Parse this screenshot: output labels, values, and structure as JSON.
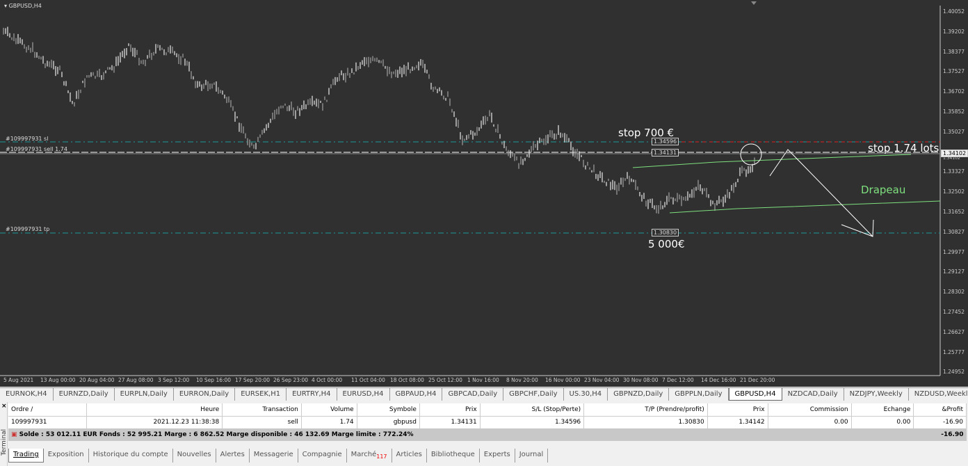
{
  "chart": {
    "symbol": "GBPUSD,H4",
    "price_axis": [
      "1.40052",
      "1.39202",
      "1.38377",
      "1.37527",
      "1.36702",
      "1.35852",
      "1.35027",
      "1.34102",
      "1.33327",
      "1.32502",
      "1.31652",
      "1.30827",
      "1.29977",
      "1.29127",
      "1.28302",
      "1.27452",
      "1.26627",
      "1.25777",
      "1.24952"
    ],
    "time_axis": [
      "5 Aug 2021",
      "13 Aug 00:00",
      "20 Aug 04:00",
      "27 Aug 08:00",
      "3 Sep 12:00",
      "10 Sep 16:00",
      "17 Sep 20:00",
      "26 Sep 23:00",
      "4 Oct 00:00",
      "11 Oct 04:00",
      "18 Oct 08:00",
      "25 Oct 12:00",
      "1 Nov 16:00",
      "8 Nov 20:00",
      "16 Nov 00:00",
      "23 Nov 04:00",
      "30 Nov 08:00",
      "7 Dec 12:00",
      "14 Dec 16:00",
      "21 Dec 20:00"
    ],
    "order_labels": {
      "sl": "#109997931 sl",
      "sell": "#109997931 sell 1.74",
      "tp": "#109997931 tp"
    },
    "level_boxes": {
      "sl": "1.34596",
      "sell": "1.34131",
      "tp": "1.30830",
      "current": "1.34102"
    },
    "annotations": {
      "stop_eur": "stop 700 €",
      "stop_lots": "stop 1.74 lots",
      "flag": "Drapeau",
      "target": "5 000€"
    },
    "colors": {
      "bg": "#303030",
      "sl": "#1a9a9a",
      "tp": "#1a9a9a",
      "channel": "#7ee07e",
      "stop": "#e02020"
    }
  },
  "chart_data": {
    "type": "line",
    "title": "GBPUSD,H4",
    "ylim": [
      1.24952,
      1.40052
    ],
    "values": [
      1.3924,
      1.388,
      1.3851,
      1.3793,
      1.3764,
      1.3618,
      1.3735,
      1.3735,
      1.3778,
      1.3866,
      1.3793,
      1.3851,
      1.3837,
      1.3807,
      1.3691,
      1.3706,
      1.3647,
      1.3531,
      1.3429,
      1.3531,
      1.3618,
      1.3589,
      1.3618,
      1.3618,
      1.3735,
      1.3749,
      1.3807,
      1.3793,
      1.3749,
      1.3764,
      1.3793,
      1.3677,
      1.3647,
      1.3473,
      1.3502,
      1.3575,
      1.3444,
      1.3371,
      1.3429,
      1.3473,
      1.3502,
      1.3429,
      1.3357,
      1.3313,
      1.3269,
      1.3313,
      1.3226,
      1.3182,
      1.3226,
      1.3211,
      1.3284,
      1.3197,
      1.3226,
      1.3327,
      1.3371
    ]
  },
  "symbol_tabs": [
    "EURNOK,H4",
    "EURNZD,Daily",
    "EURPLN,Daily",
    "EURRON,Daily",
    "EURSEK,H1",
    "EURTRY,H4",
    "EURUSD,H4",
    "GBPAUD,H4",
    "GBPCAD,Daily",
    "GBPCHF,Daily",
    "US.30,H4",
    "GBPNZD,Daily",
    "GBPPLN,Daily",
    "GBPUSD,H4",
    "NZDCAD,Daily",
    "NZDJPY,Weekly",
    "NZDUSD,Weekly"
  ],
  "terminal": {
    "side_label": "Terminal",
    "close": "×",
    "headers": [
      "Ordre  /",
      "Heure",
      "Transaction",
      "Volume",
      "Symbole",
      "Prix",
      "S/L (Stop/Perte)",
      "T/P (Prendre/profit)",
      "Prix",
      "Commission",
      "Echange",
      "&Profit"
    ],
    "row": [
      "109997931",
      "2021.12.23 11:38:38",
      "sell",
      "1.74",
      "gbpusd",
      "1.34131",
      "1.34596",
      "1.30830",
      "1.34142",
      "0.00",
      "0.00",
      "-16.90"
    ],
    "summary": "Solde : 53 012.11 EUR  Fonds : 52 995.21  Marge : 6 862.52  Marge disponible : 46 132.69  Marge limite : 772.24%",
    "total": "-16.90",
    "tabs": [
      "Trading",
      "Exposition",
      "Historique du compte",
      "Nouvelles",
      "Alertes",
      "Messagerie",
      "Compagnie",
      "Marché",
      "Articles",
      "Bibliotheque",
      "Experts",
      "Journal"
    ],
    "market_badge": "117"
  }
}
